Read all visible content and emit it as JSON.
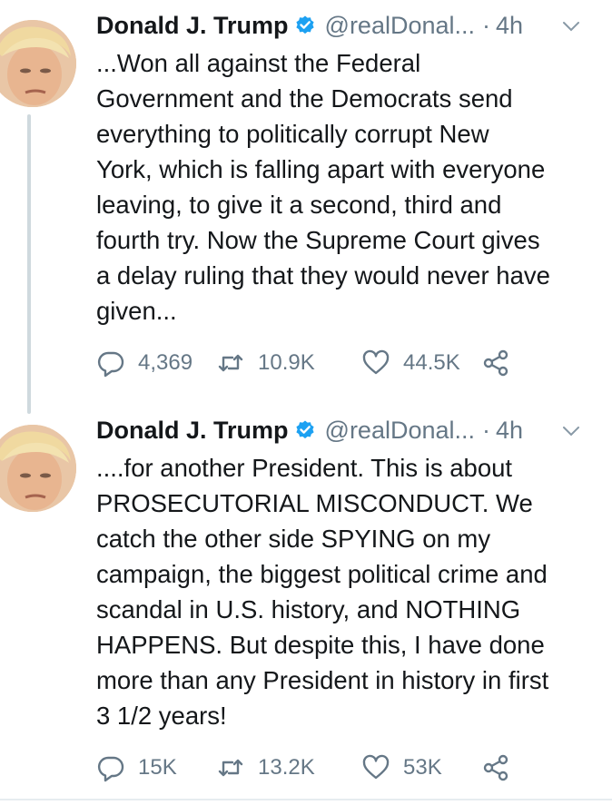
{
  "tweets": [
    {
      "name": "Donald J. Trump",
      "handle": "@realDonal...",
      "dot": "·",
      "time": "4h",
      "text": "...Won all against the Federal\nGovernment and the Democrats send\neverything to politically corrupt New\nYork, which is falling apart with everyone\nleaving, to give it a second, third and\nfourth try. Now the Supreme Court gives\na delay ruling that they would never have\ngiven...",
      "replies": "4,369",
      "retweets": "10.9K",
      "likes": "44.5K"
    },
    {
      "name": "Donald J. Trump",
      "handle": "@realDonal...",
      "dot": "·",
      "time": "4h",
      "text": "....for another President. This is about\nPROSECUTORIAL MISCONDUCT. We\ncatch the other side SPYING on my\ncampaign, the biggest political crime and\nscandal in U.S. history, and NOTHING\nHAPPENS. But despite this, I have done\nmore than any President in history in first\n3 1/2 years!",
      "replies": "15K",
      "retweets": "13.2K",
      "likes": "53K"
    }
  ],
  "colors": {
    "verified": "#1da1f2",
    "muted": "#657786",
    "text": "#14171a",
    "thread_line": "#cfd9de"
  },
  "icons": [
    "reply-icon",
    "retweet-icon",
    "like-icon",
    "share-icon",
    "verified-icon",
    "chevron-down-icon"
  ]
}
